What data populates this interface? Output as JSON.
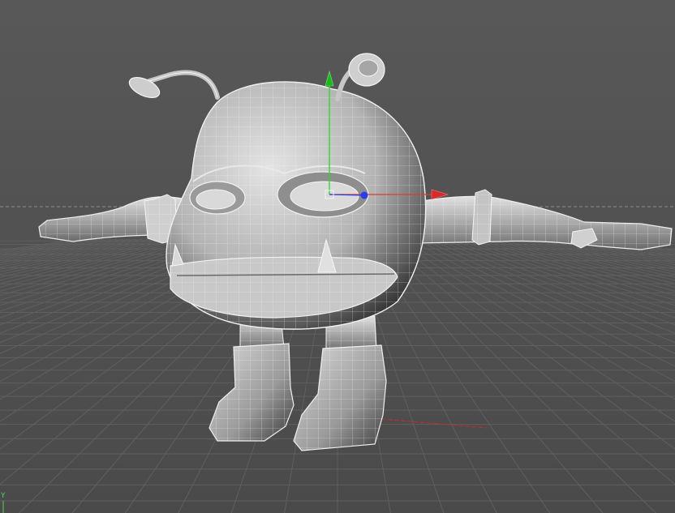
{
  "viewport": {
    "background_top": "#575757",
    "background_bottom": "#4a4a4a",
    "horizon_line_color": "#8a8a8a",
    "grid_color": "#5d5d5d",
    "world_axis_x_color": "#cc2a2a",
    "mesh_fill": "#bdbdbd",
    "mesh_wire": "#f2f2f2",
    "gizmo": {
      "x_axis_color": "#e23a3a",
      "y_axis_color": "#2bd62b",
      "z_axis_color": "#2f3fe0",
      "handle_icons": [
        "move-x-arrow-icon",
        "move-y-arrow-icon",
        "move-z-dot-icon"
      ]
    },
    "corner_axis": {
      "icon": "world-axis-indicator-icon",
      "y_label": "Y",
      "y_color": "#53d053"
    }
  }
}
